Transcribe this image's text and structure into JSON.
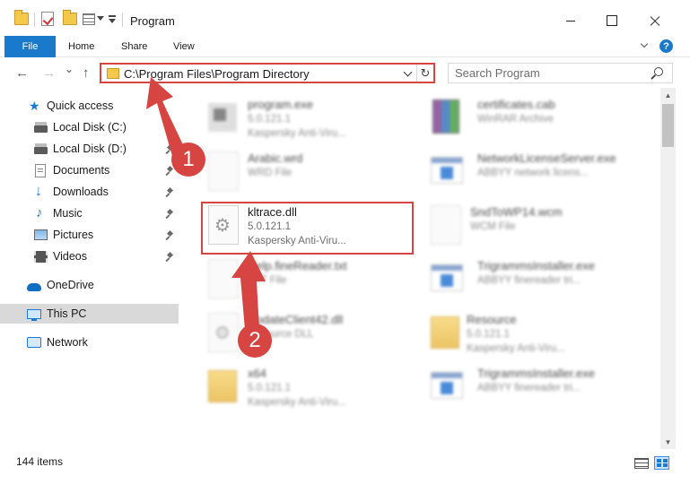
{
  "window": {
    "title": "Program",
    "controls": {
      "minimize": "minimize",
      "maximize": "maximize",
      "close": "close"
    }
  },
  "ribbon": {
    "tabs": [
      {
        "label": "File",
        "active": true
      },
      {
        "label": "Home"
      },
      {
        "label": "Share"
      },
      {
        "label": "View"
      }
    ],
    "help_label": "?"
  },
  "navigation": {
    "back_glyph": "←",
    "forward_glyph": "→",
    "recent_glyph": "⌄",
    "up_glyph": "↑",
    "address": "C:\\Program Files\\Program Directory",
    "refresh_glyph": "↻",
    "search_placeholder": "Search Program"
  },
  "sidebar": {
    "items": [
      {
        "label": "Quick access",
        "icon": "star-icon",
        "pinned": false
      },
      {
        "label": "Local Disk (C:)",
        "icon": "drive-icon",
        "pinned": true
      },
      {
        "label": "Local Disk (D:)",
        "icon": "drive-icon",
        "pinned": true
      },
      {
        "label": "Documents",
        "icon": "documents-icon",
        "pinned": true
      },
      {
        "label": "Downloads",
        "icon": "downloads-icon",
        "pinned": true
      },
      {
        "label": "Music",
        "icon": "music-icon",
        "pinned": true
      },
      {
        "label": "Pictures",
        "icon": "pictures-icon",
        "pinned": true
      },
      {
        "label": "Videos",
        "icon": "videos-icon",
        "pinned": true
      },
      {
        "label": "OneDrive",
        "icon": "onedrive-icon",
        "pinned": false
      },
      {
        "label": "This PC",
        "icon": "this-pc-icon",
        "pinned": false,
        "selected": true
      },
      {
        "label": "Network",
        "icon": "network-icon",
        "pinned": false
      }
    ]
  },
  "files": [
    {
      "name": "program.exe",
      "line2": "5.0.121.1",
      "line3": "Kaspersky Anti-Viru...",
      "icon": "exe-icon",
      "blurred": true
    },
    {
      "name": "certificates.cab",
      "line2": "WinRAR Archive",
      "line3": "",
      "icon": "archive-icon",
      "blurred": true
    },
    {
      "name": "Arabic.wrd",
      "line2": "WRD File",
      "line3": "",
      "icon": "file-icon",
      "blurred": true
    },
    {
      "name": "NetworkLicenseServer.exe",
      "line2": "ABBYY network licens...",
      "line3": "",
      "icon": "installer-icon",
      "blurred": true
    },
    {
      "name": "kltrace.dll",
      "line2": "5.0.121.1",
      "line3": "Kaspersky Anti-Viru...",
      "icon": "dll-gear-icon",
      "blurred": false,
      "highlighted": true
    },
    {
      "name": "SndToWP14.wcm",
      "line2": "WCM File",
      "line3": "",
      "icon": "file-icon",
      "blurred": true
    },
    {
      "name": "Help.fineReader.txt",
      "line2": "TXT File",
      "line3": "",
      "icon": "file-icon",
      "blurred": true
    },
    {
      "name": "TrigrammsInstaller.exe",
      "line2": "ABBYY finereader tri...",
      "line3": "",
      "icon": "installer-icon",
      "blurred": true
    },
    {
      "name": "UpdateClient42.dll",
      "line2": "Resource DLL",
      "line3": "",
      "icon": "dll-gear-icon",
      "blurred": true
    },
    {
      "name": "Resource",
      "line2": "5.0.121.1",
      "line3": "Kaspersky Anti-Viru...",
      "icon": "folder-icon",
      "blurred": true
    },
    {
      "name": "x64",
      "line2": "5.0.121.1",
      "line3": "Kaspersky Anti-Viru...",
      "icon": "folder-icon",
      "blurred": true
    },
    {
      "name": "TrigrammsInstaller.exe",
      "line2": "ABBYY finereader tri...",
      "line3": "",
      "icon": "installer-icon",
      "blurred": true
    }
  ],
  "status": {
    "item_count": "144 items"
  },
  "annotations": [
    {
      "number": "1"
    },
    {
      "number": "2"
    }
  ],
  "colors": {
    "accent": "#1979ca",
    "annotation_red": "#d64541",
    "folder_yellow": "#f3c84b",
    "selected_bg": "#d9d9d9"
  }
}
